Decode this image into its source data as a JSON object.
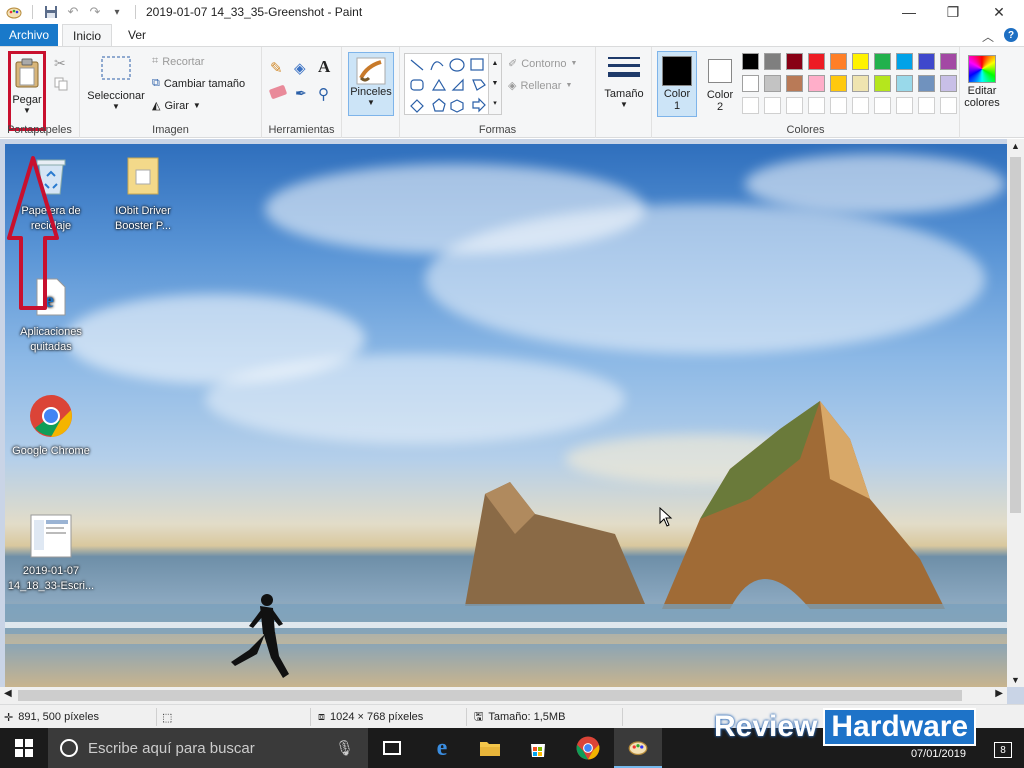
{
  "window": {
    "title": "2019-01-07 14_33_35-Greenshot - Paint"
  },
  "tabs": {
    "file": "Archivo",
    "home": "Inicio",
    "view": "Ver"
  },
  "ribbon": {
    "clipboard": {
      "label": "Portapapeles",
      "paste": "Pegar"
    },
    "image": {
      "label": "Imagen",
      "select": "Seleccionar",
      "crop": "Recortar",
      "resize": "Cambiar tamaño",
      "rotate": "Girar"
    },
    "tools": {
      "label": "Herramientas"
    },
    "brushes": {
      "label": "Pinceles"
    },
    "shapes": {
      "label": "Formas",
      "outline": "Contorno",
      "fill": "Rellenar"
    },
    "size": {
      "label": "Tamaño"
    },
    "color1": {
      "label": "Color",
      "num": "1",
      "value": "#000000"
    },
    "color2": {
      "label": "Color",
      "num": "2",
      "value": "#ffffff"
    },
    "colors": {
      "label": "Colores",
      "edit": "Editar colores",
      "row1": [
        "#000000",
        "#7f7f7f",
        "#880015",
        "#ed1c24",
        "#ff7f27",
        "#fff200",
        "#22b14c",
        "#00a2e8",
        "#3f48cc",
        "#a349a4"
      ],
      "row2": [
        "#ffffff",
        "#c3c3c3",
        "#b97a57",
        "#ffaec9",
        "#ffc90e",
        "#efe4b0",
        "#b5e61d",
        "#99d9ea",
        "#7092be",
        "#c8bfe7"
      ]
    }
  },
  "desktop": {
    "icons": [
      {
        "label": "Papelera de reciclaje",
        "icon": "recycle-bin-icon"
      },
      {
        "label": "IObit Driver Booster P...",
        "icon": "folder-icon"
      },
      {
        "label": "Aplicaciones quitadas",
        "icon": "document-icon"
      },
      {
        "label": "Google Chrome",
        "icon": "chrome-icon"
      },
      {
        "label": "2019-01-07 14_18_33-Escri...",
        "icon": "screenshot-file-icon"
      }
    ]
  },
  "status": {
    "position": "891, 500 píxeles",
    "size": "1024 × 768 píxeles",
    "filesize": "Tamaño: 1,5MB"
  },
  "taskbar": {
    "search_placeholder": "Escribe aquí para buscar",
    "date": "07/01/2019",
    "notifications": "8"
  },
  "watermark": {
    "part1": "Review",
    "part2": "Hardware"
  },
  "accent": "#1979ca"
}
